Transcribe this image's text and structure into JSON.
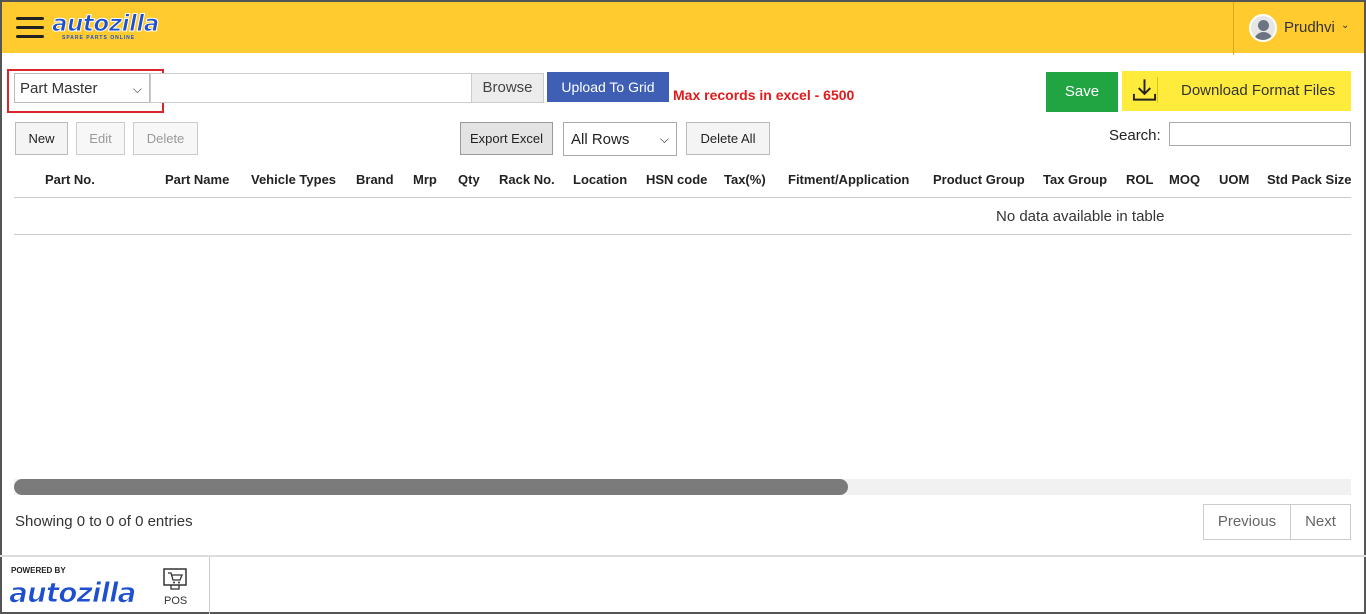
{
  "header": {
    "logo_text": "autozilla",
    "logo_tagline": "SPARE PARTS ONLINE",
    "username": "Prudhvi"
  },
  "toolbar": {
    "master_select": "Part Master",
    "browse_label": "Browse",
    "upload_label": "Upload To Grid",
    "max_records_note": "Max records in excel - 6500",
    "save_label": "Save",
    "download_label": "Download Format Files",
    "new_label": "New",
    "edit_label": "Edit",
    "delete_label": "Delete",
    "export_label": "Export Excel",
    "rows_select": "All Rows",
    "delete_all_label": "Delete All",
    "search_label": "Search:"
  },
  "table": {
    "columns": [
      "Part No.",
      "Part Name",
      "Vehicle Types",
      "Brand",
      "Mrp",
      "Qty",
      "Rack No.",
      "Location",
      "HSN code",
      "Tax(%)",
      "Fitment/Application",
      "Product Group",
      "Tax Group",
      "ROL",
      "MOQ",
      "UOM",
      "Std Pack Size"
    ],
    "empty_message": "No data available in table"
  },
  "pagination": {
    "info": "Showing 0 to 0 of 0 entries",
    "previous_label": "Previous",
    "next_label": "Next"
  },
  "footer": {
    "powered_by": "POWERED BY",
    "logo_text": "autozilla",
    "pos_label": "POS"
  },
  "colors": {
    "header_bg": "#ffcb2e",
    "save_bg": "#21a442",
    "upload_bg": "#3f5fb5",
    "download_bg": "#ffeb3b",
    "warning_text": "#e01b1b",
    "highlight_border": "#d9262c"
  }
}
